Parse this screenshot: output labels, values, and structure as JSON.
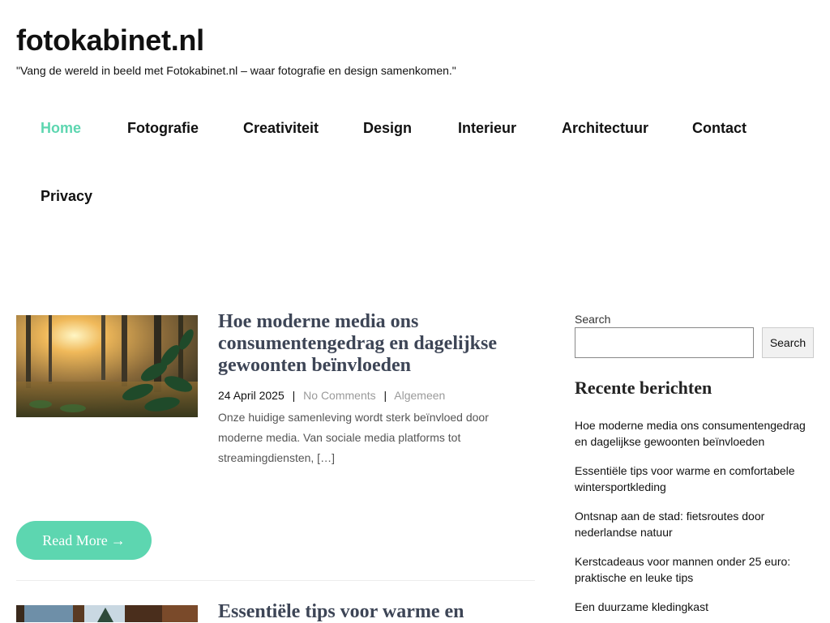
{
  "site": {
    "title": "fotokabinet.nl",
    "tagline": "\"Vang de wereld in beeld met Fotokabinet.nl – waar fotografie en design samenkomen.\""
  },
  "nav": {
    "items": [
      {
        "label": "Home",
        "active": true
      },
      {
        "label": "Fotografie"
      },
      {
        "label": "Creativiteit"
      },
      {
        "label": "Design"
      },
      {
        "label": "Interieur"
      },
      {
        "label": "Architectuur"
      },
      {
        "label": "Contact"
      },
      {
        "label": "Privacy"
      }
    ]
  },
  "posts": [
    {
      "title": "Hoe moderne media ons consumentengedrag en dagelijkse gewoonten beïnvloeden",
      "date": "24 April 2025",
      "comments": "No Comments",
      "category": "Algemeen",
      "excerpt": "Onze huidige samenleving wordt sterk beïnvloed door moderne media. Van sociale media platforms tot streamingdiensten, […]",
      "read_more": "Read More",
      "read_more_icon": "arrow-right-icon"
    },
    {
      "title": "Essentiële tips voor warme en"
    }
  ],
  "sidebar": {
    "search_label": "Search",
    "search_placeholder": "",
    "search_button": "Search",
    "recent_title": "Recente berichten",
    "recent_posts": [
      "Hoe moderne media ons consumentengedrag en dagelijkse gewoonten beïnvloeden",
      "Essentiële tips voor warme en comfortabele wintersportkleding",
      "Ontsnap aan de stad: fietsroutes door nederlandse natuur",
      "Kerstcadeaus voor mannen onder 25 euro: praktische en leuke tips",
      "Een duurzame kledingkast"
    ]
  },
  "colors": {
    "accent": "#5dd6b0",
    "post_title": "#3d4556"
  }
}
